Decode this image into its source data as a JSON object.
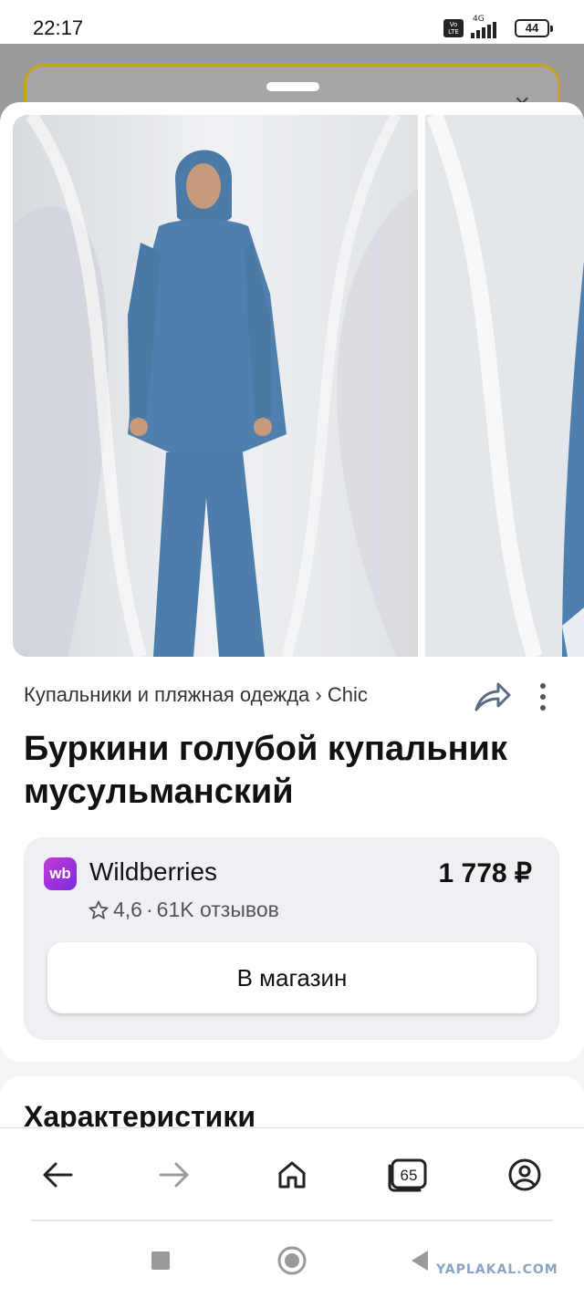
{
  "status_bar": {
    "time": "22:17",
    "volte": "Vo LTE",
    "network": "4G",
    "battery": "44"
  },
  "backdrop": {
    "close_glyph": "×"
  },
  "product": {
    "breadcrumb": "Купальники и пляжная одежда › Chic",
    "title": "Буркини голубой купальник мусульманский",
    "images": [
      "photo-model-front",
      "photo-model-partial"
    ]
  },
  "offer": {
    "shop_logo": "wb",
    "shop_name": "Wildberries",
    "price": "1 778 ₽",
    "rating": "4,6",
    "separator": "·",
    "reviews": "61K отзывов",
    "button": "В магазин"
  },
  "section": {
    "heading": "Характеристики"
  },
  "browser_bar": {
    "items": [
      {
        "name": "back-arrow-icon"
      },
      {
        "name": "forward-arrow-icon"
      },
      {
        "name": "home-icon"
      },
      {
        "name": "tabs-icon",
        "count": "65"
      },
      {
        "name": "profile-icon"
      }
    ]
  },
  "system_nav": [
    "recents-square-icon",
    "home-circle-icon",
    "back-triangle-icon"
  ],
  "watermark": "YAPLAKAL.COM",
  "colors": {
    "accent_gold": "#c9a21a",
    "wb_purple": "#a33ad8",
    "card_bg": "#eef0f3"
  }
}
